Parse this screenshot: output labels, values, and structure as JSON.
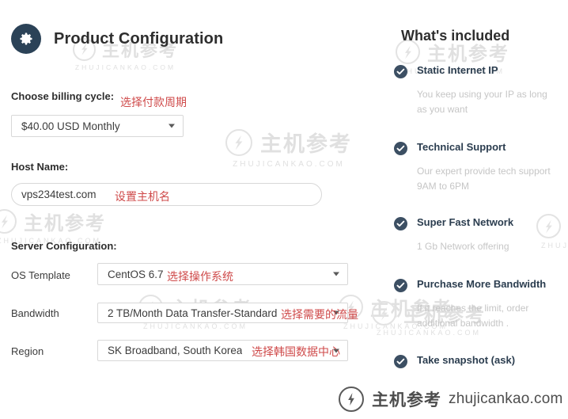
{
  "header": {
    "icon": "gear-icon",
    "title": "Product Configuration"
  },
  "form": {
    "billing": {
      "label": "Choose billing cycle:",
      "annotation": "选择付款周期",
      "value": "$40.00 USD Monthly",
      "caret_icon": "chevron-down-icon"
    },
    "hostname": {
      "label": "Host Name:",
      "annotation": "设置主机名",
      "value": "vps234test.com",
      "placeholder": "vps234test.com"
    },
    "server_config": {
      "label": "Server Configuration:",
      "rows": [
        {
          "label": "OS Template",
          "value": "CentOS 6.7",
          "annotation": "选择操作系统",
          "caret_icon": "chevron-down-icon"
        },
        {
          "label": "Bandwidth",
          "value": "2 TB/Month Data Transfer-Standard",
          "annotation": "选择需要的流量",
          "caret_icon": "chevron-down-icon"
        },
        {
          "label": "Region",
          "value": "SK Broadband, South Korea",
          "annotation": "选择韩国数据中心",
          "caret_icon": "chevron-down-icon"
        }
      ]
    }
  },
  "included": {
    "title": "What's included",
    "items": [
      {
        "icon": "check-circle-icon",
        "title": "Static Internet IP",
        "description": "You keep using your IP as long as you want"
      },
      {
        "icon": "check-circle-icon",
        "title": "Technical Support",
        "description": "Our expert provide tech support 9AM to 6PM"
      },
      {
        "icon": "check-circle-icon",
        "title": "Super Fast Network",
        "description": "1 Gb Network offering"
      },
      {
        "icon": "check-circle-icon",
        "title": "Purchase More Bandwidth",
        "description": "If it reaches the limit, order additional bandwidth ."
      },
      {
        "icon": "check-circle-icon",
        "title": "Take snapshot (ask)",
        "description": ""
      }
    ]
  },
  "watermarks": {
    "cn": "主机参考",
    "en": "ZHUJICANKAO.COM",
    "brand_cn": "主机参考",
    "brand_en": "zhujicankao.com"
  },
  "colors": {
    "badge_navy": "#2b4257",
    "check_navy": "#3c4f63",
    "annotation_red": "#cf4a4a",
    "muted_text": "#c6c6c6",
    "border": "#d8d8d8"
  }
}
